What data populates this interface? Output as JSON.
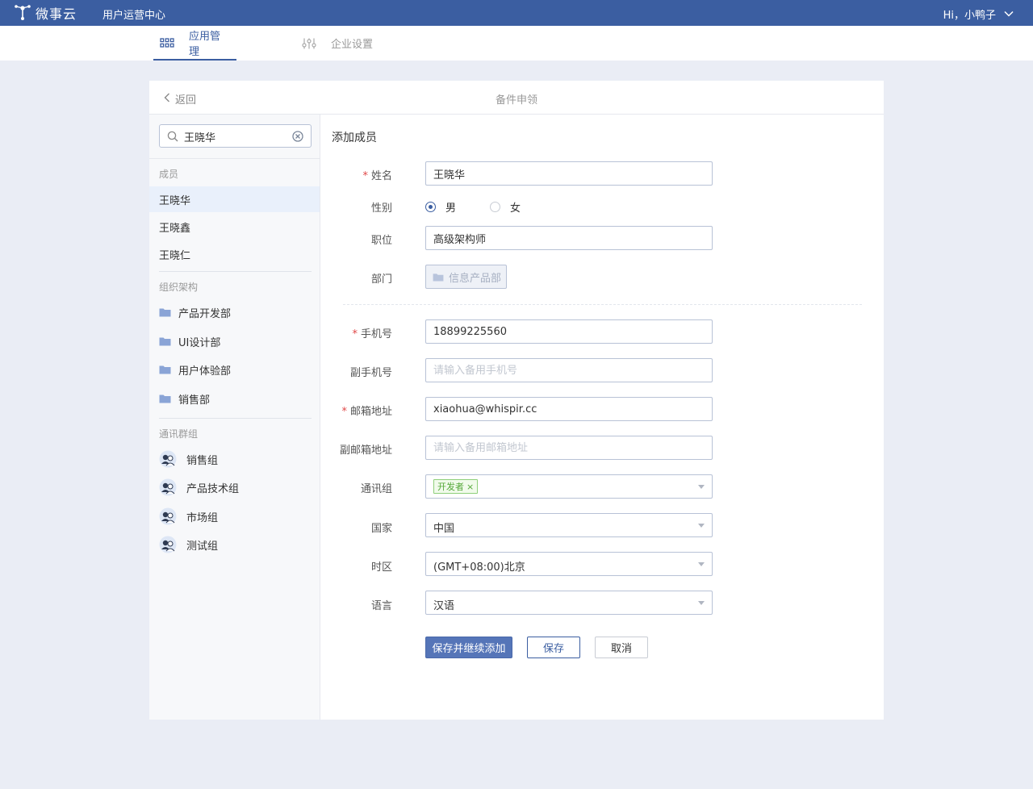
{
  "colors": {
    "brand": "#3b5ea1",
    "page_bg": "#eaedf5",
    "required": "#e04848",
    "tag_green": "#55a83a"
  },
  "topbar": {
    "logo_text": "微事云",
    "app_name": "用户运营中心",
    "user_greeting": "Hi，小鸭子",
    "user_icon": "chevron-down-icon"
  },
  "nav": {
    "tabs": [
      {
        "label": "应用管理",
        "icon": "grid-icon",
        "active": true
      },
      {
        "label": "企业设置",
        "icon": "sliders-icon",
        "active": false
      }
    ]
  },
  "card": {
    "back_label": "返回",
    "title": "备件申领"
  },
  "left_panel": {
    "search_value": "王晓华",
    "members_label": "成员",
    "members": [
      "王晓华",
      "王晓鑫",
      "王晓仁"
    ],
    "selected_member": "王晓华",
    "org_label": "组织架构",
    "departments": [
      "产品开发部",
      "UI设计部",
      "用户体验部",
      "销售部"
    ],
    "groups_label": "通讯群组",
    "groups": [
      "销售组",
      "产品技术组",
      "市场组",
      "测试组"
    ]
  },
  "form": {
    "title": "添加成员",
    "name": {
      "label": "姓名",
      "required": true,
      "value": "王晓华"
    },
    "gender": {
      "label": "性别",
      "options": [
        "男",
        "女"
      ],
      "selected": "男"
    },
    "position": {
      "label": "职位",
      "value": "高级架构师"
    },
    "department": {
      "label": "部门",
      "value": "信息产品部"
    },
    "mobile": {
      "label": "手机号",
      "required": true,
      "value": "18899225560"
    },
    "alt_mobile": {
      "label": "副手机号",
      "placeholder": "请输入备用手机号"
    },
    "email": {
      "label": "邮箱地址",
      "required": true,
      "value": "xiaohua@whispir.cc"
    },
    "alt_email": {
      "label": "副邮箱地址",
      "placeholder": "请输入备用邮箱地址"
    },
    "comm_group": {
      "label": "通讯组",
      "tags": [
        "开发者"
      ]
    },
    "country": {
      "label": "国家",
      "value": "中国"
    },
    "timezone": {
      "label": "时区",
      "value": "(GMT+08:00)北京"
    },
    "language": {
      "label": "语言",
      "value": "汉语"
    },
    "buttons": {
      "save_continue": "保存并继续添加",
      "save": "保存",
      "cancel": "取消"
    }
  }
}
